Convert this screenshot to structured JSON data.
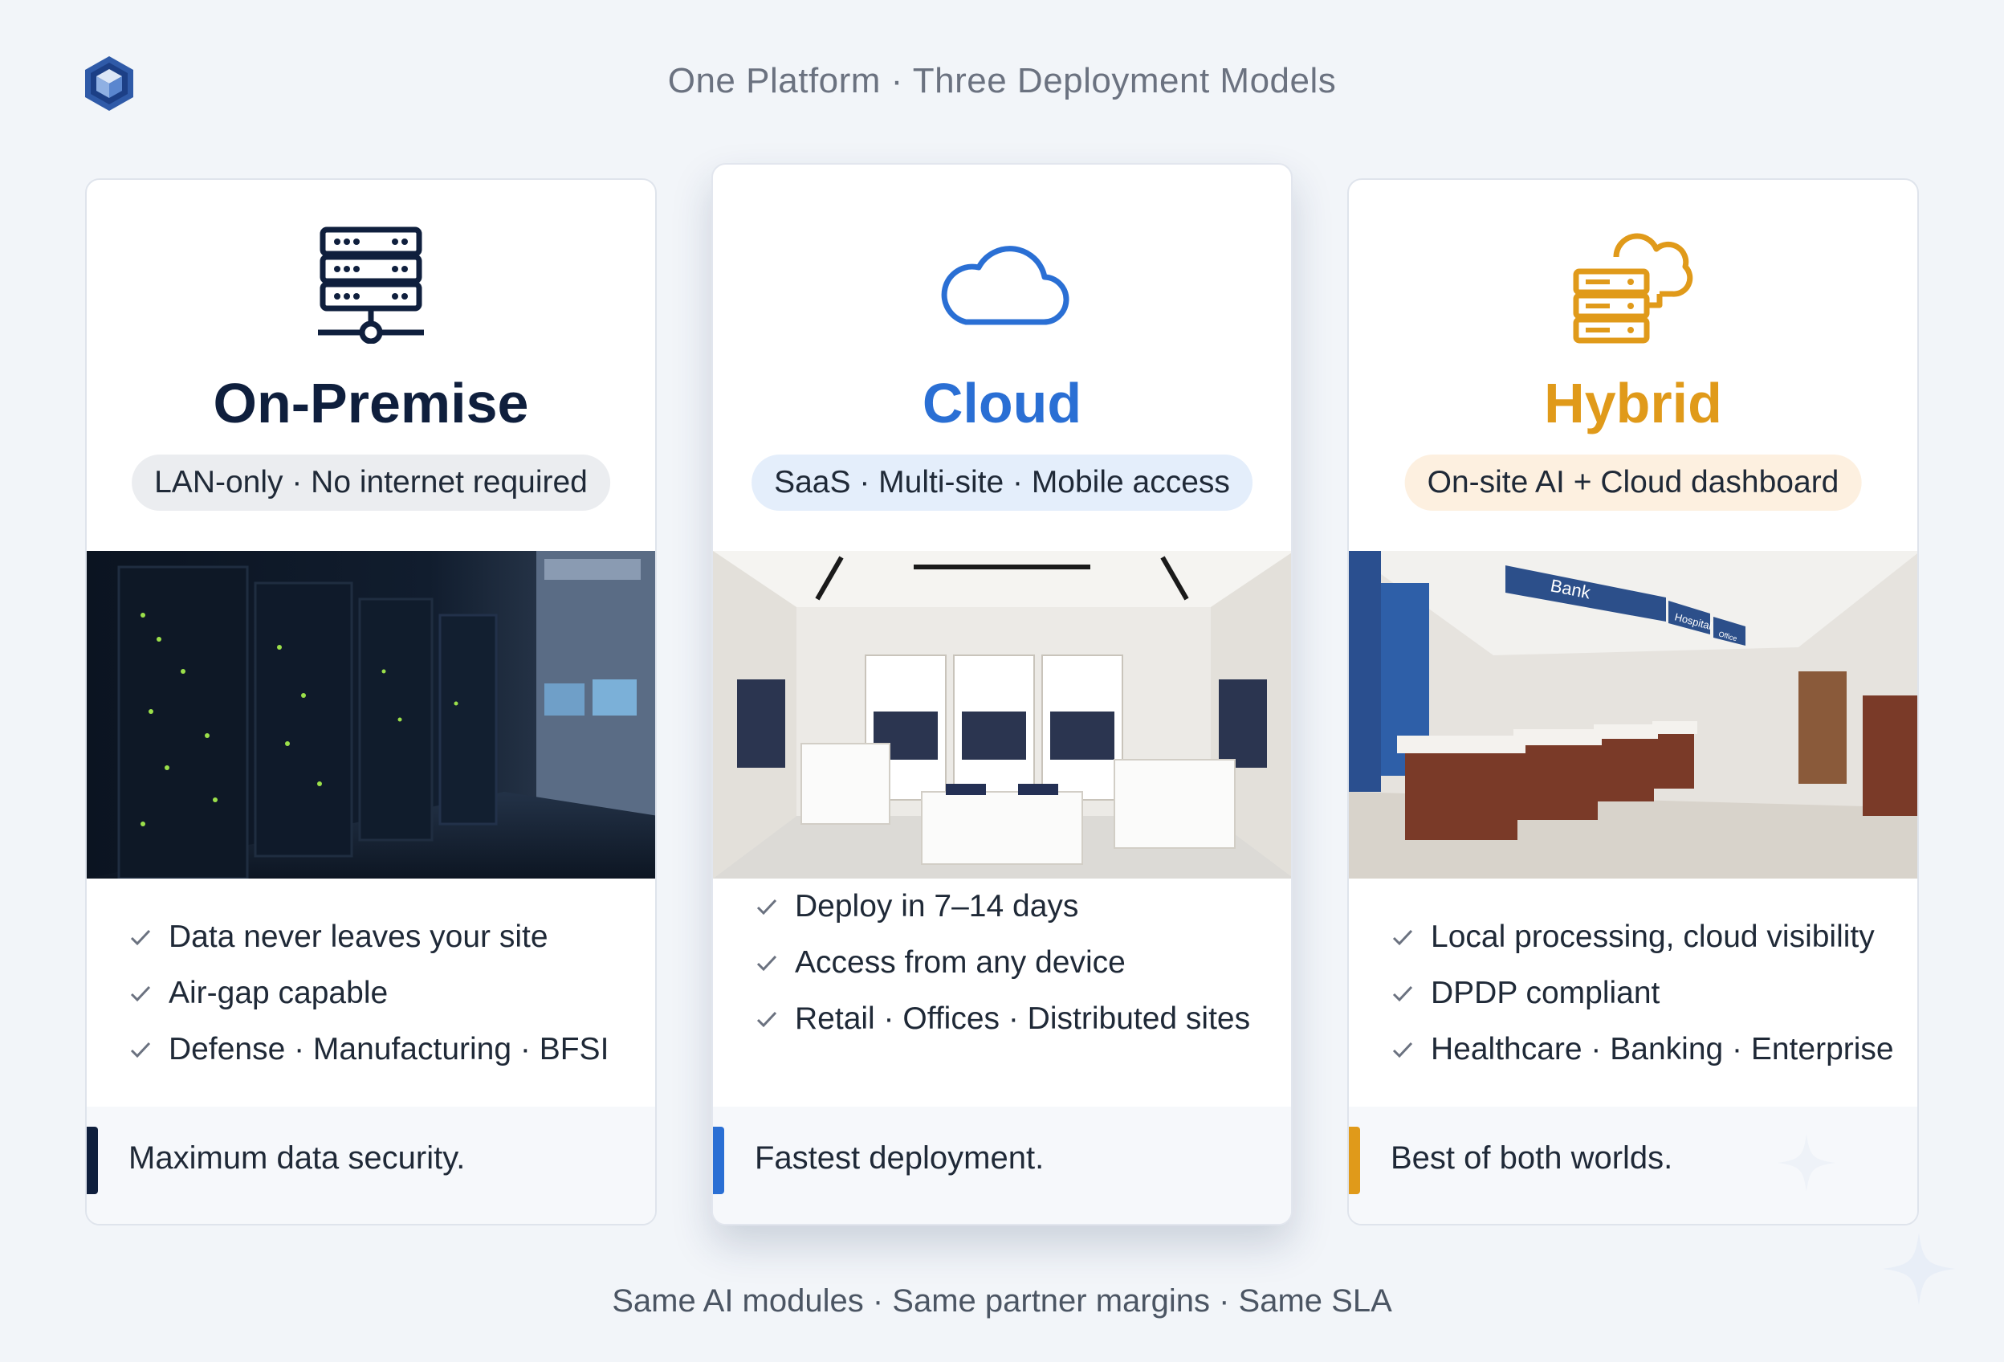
{
  "header": {
    "logo_icon": "hexagon-cube-icon",
    "title": "One Platform · Three Deployment Models"
  },
  "cards": [
    {
      "icon": "server-rack-icon",
      "title": "On-Premise",
      "accent": "#0f1f3d",
      "pill": "LAN-only · No internet required",
      "pill_bg": "#ebedf0",
      "photo_icon": "data-center-photo",
      "features": [
        "Data never leaves your site",
        "Air-gap capable",
        "Defense · Manufacturing · BFSI"
      ],
      "tagline": "Maximum data security."
    },
    {
      "icon": "cloud-icon",
      "title": "Cloud",
      "accent": "#2a6fd4",
      "pill": "SaaS · Multi-site · Mobile access",
      "pill_bg": "#e4eefb",
      "photo_icon": "retail-store-photo",
      "features": [
        "Deploy in 7–14 days",
        "Access from any device",
        "Retail · Offices · Distributed sites"
      ],
      "tagline": "Fastest deployment."
    },
    {
      "icon": "server-cloud-icon",
      "title": "Hybrid",
      "accent": "#e09a1a",
      "pill": "On-site AI + Cloud dashboard",
      "pill_bg": "#fdf0e0",
      "photo_icon": "bank-hospital-lobby-photo",
      "photo_signs": [
        "Bank",
        "Hospital",
        "Office"
      ],
      "features": [
        "Local processing, cloud visibility",
        "DPDP compliant",
        "Healthcare · Banking · Enterprise"
      ],
      "tagline": "Best of both worlds."
    }
  ],
  "footer": {
    "caption": "Same AI modules · Same partner margins · Same SLA"
  },
  "check_icon": "check-icon",
  "sparkle_icon": "sparkle-icon"
}
